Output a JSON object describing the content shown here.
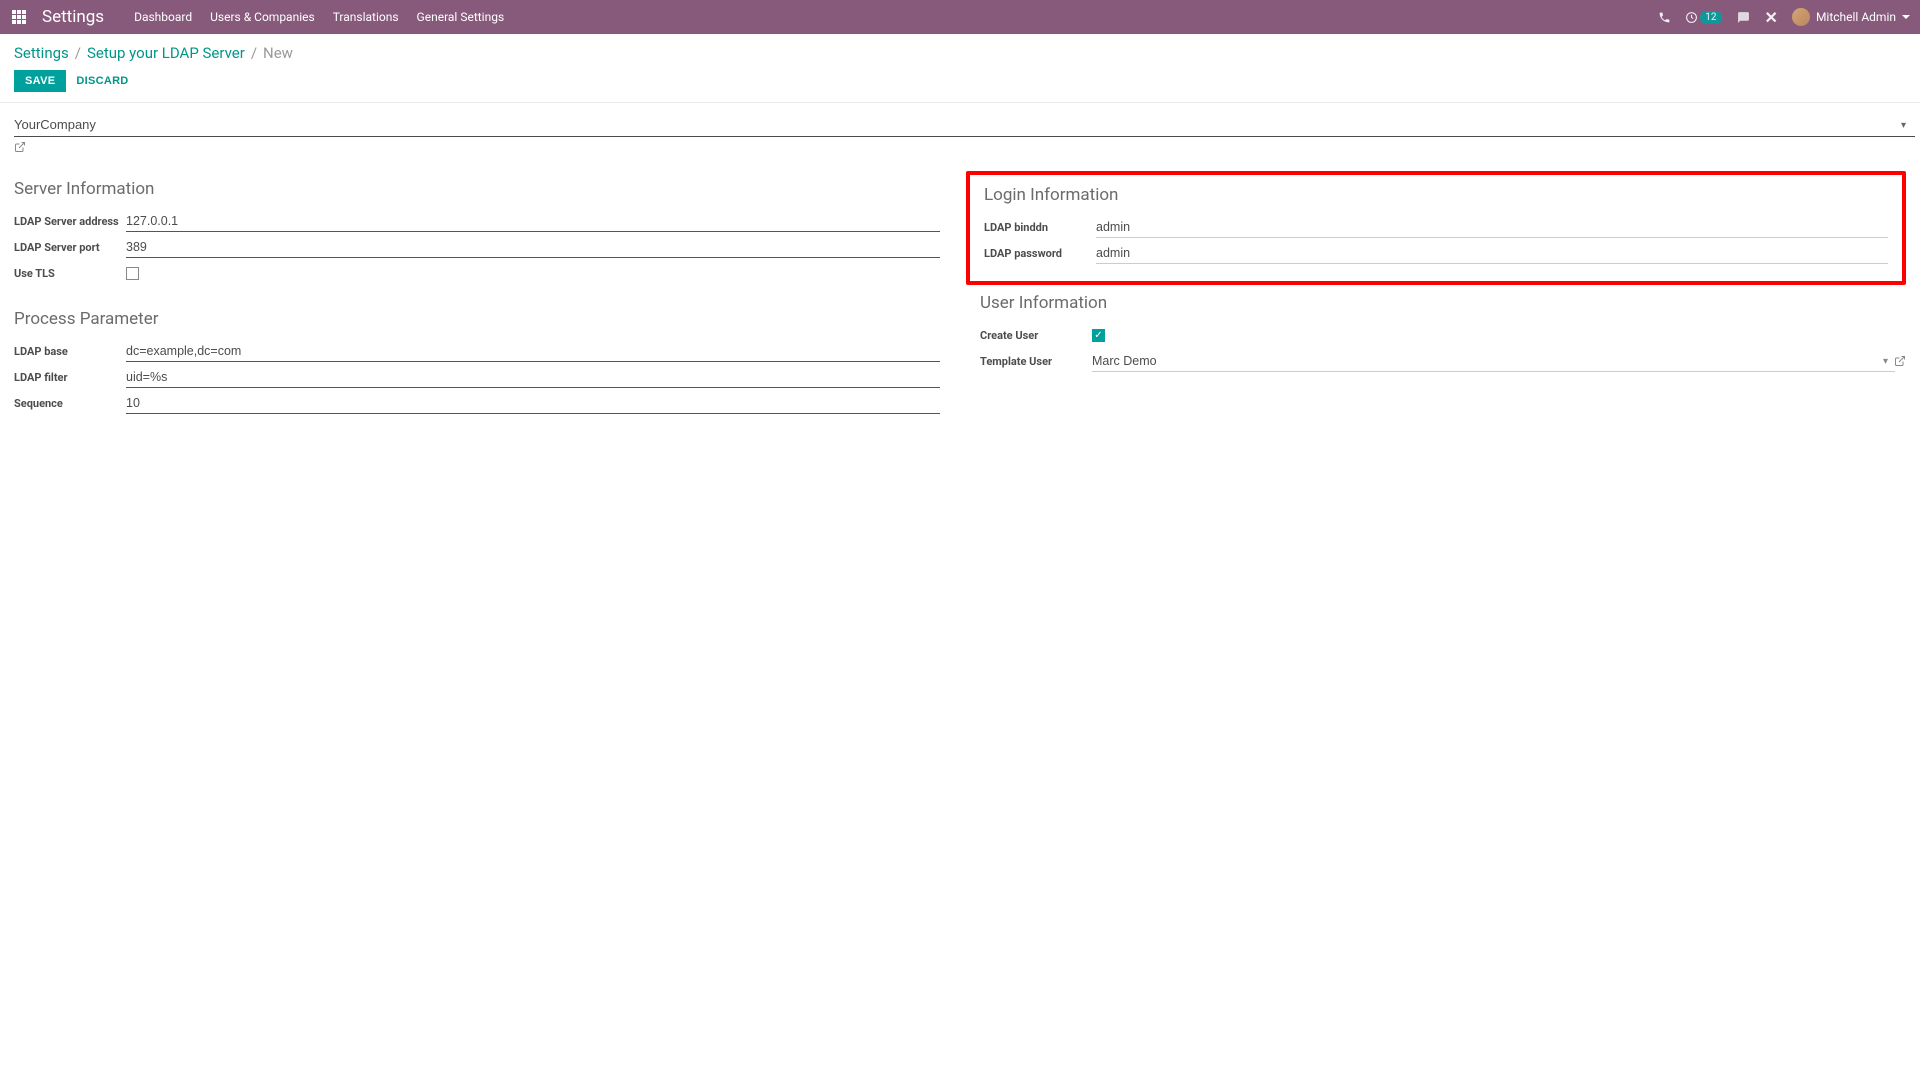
{
  "navbar": {
    "brand": "Settings",
    "menu": [
      "Dashboard",
      "Users & Companies",
      "Translations",
      "General Settings"
    ],
    "activity_count": "12",
    "user_name": "Mitchell Admin"
  },
  "breadcrumbs": {
    "root": "Settings",
    "mid": "Setup your LDAP Server",
    "current": "New"
  },
  "actions": {
    "save": "SAVE",
    "discard": "DISCARD"
  },
  "company": "YourCompany",
  "sections": {
    "server": {
      "title": "Server Information",
      "address_label": "LDAP Server address",
      "address_value": "127.0.0.1",
      "port_label": "LDAP Server port",
      "port_value": "389",
      "tls_label": "Use TLS"
    },
    "process": {
      "title": "Process Parameter",
      "base_label": "LDAP base",
      "base_value": "dc=example,dc=com",
      "filter_label": "LDAP filter",
      "filter_value": "uid=%s",
      "sequence_label": "Sequence",
      "sequence_value": "10"
    },
    "login": {
      "title": "Login Information",
      "binddn_label": "LDAP binddn",
      "binddn_value": "admin",
      "password_label": "LDAP password",
      "password_value": "admin"
    },
    "user": {
      "title": "User Information",
      "create_user_label": "Create User",
      "template_user_label": "Template User",
      "template_user_value": "Marc Demo"
    }
  }
}
